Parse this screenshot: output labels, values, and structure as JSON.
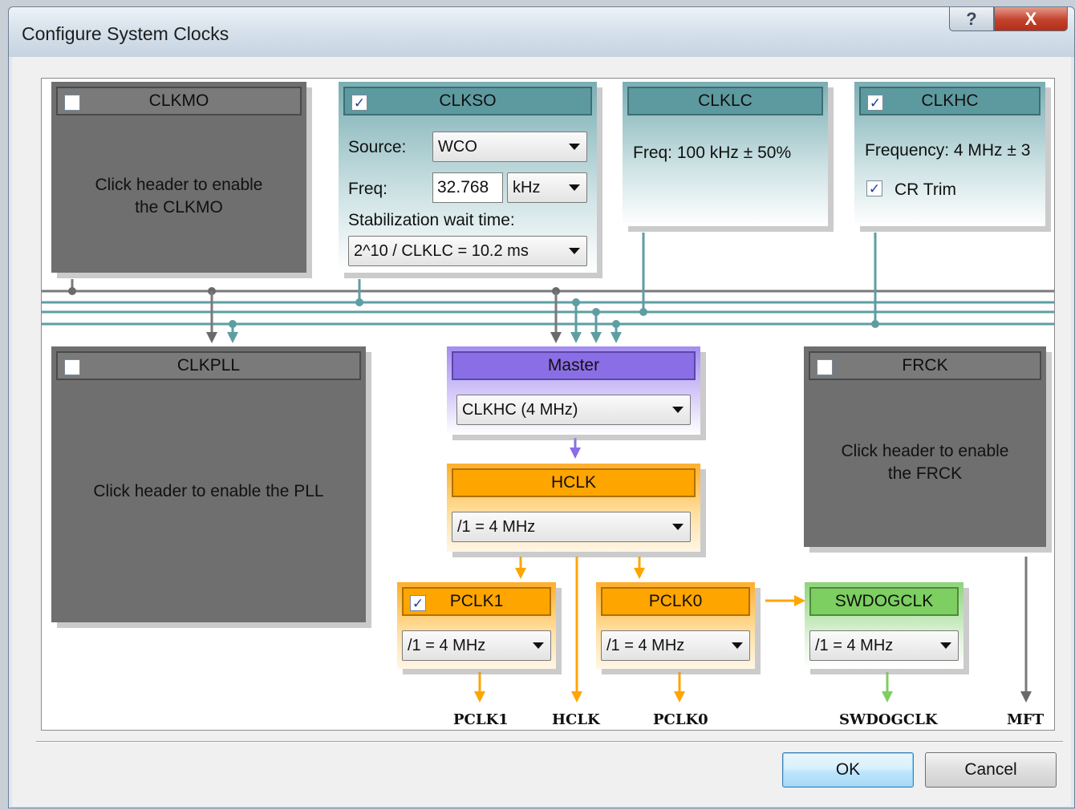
{
  "window": {
    "title": "Configure System Clocks",
    "help_glyph": "?",
    "close_glyph": "X"
  },
  "clkmo": {
    "title": "CLKMO",
    "enabled": false,
    "message": "Click header to enable the CLKMO"
  },
  "clkso": {
    "title": "CLKSO",
    "enabled": true,
    "source_label": "Source:",
    "source_value": "WCO",
    "freq_label": "Freq:",
    "freq_value": "32.768",
    "freq_unit": "kHz",
    "stab_label": "Stabilization wait time:",
    "stab_value": "2^10 / CLKLC = 10.2 ms"
  },
  "clklc": {
    "title": "CLKLC",
    "freq_text": "Freq: 100 kHz ± 50%"
  },
  "clkhc": {
    "title": "CLKHC",
    "enabled": true,
    "freq_text": "Frequency: 4 MHz ± 3",
    "cr_trim_label": "CR Trim",
    "cr_trim_checked": true
  },
  "clkpll": {
    "title": "CLKPLL",
    "enabled": false,
    "message": "Click header to enable the PLL"
  },
  "master": {
    "title": "Master",
    "value": "CLKHC (4 MHz)"
  },
  "frck": {
    "title": "FRCK",
    "enabled": false,
    "message": "Click header to enable the FRCK"
  },
  "hclk": {
    "title": "HCLK",
    "value": "/1 = 4 MHz"
  },
  "pclk1": {
    "title": "PCLK1",
    "enabled": true,
    "value": "/1 = 4 MHz"
  },
  "pclk0": {
    "title": "PCLK0",
    "value": "/1 = 4 MHz"
  },
  "swdogclk": {
    "title": "SWDOGCLK",
    "value": "/1 = 4 MHz"
  },
  "outputs": {
    "pclk1": "PCLK1",
    "hclk": "HCLK",
    "pclk0": "PCLK0",
    "swdogclk": "SWDOGCLK",
    "mft": "MFT"
  },
  "buttons": {
    "ok": "OK",
    "cancel": "Cancel"
  },
  "colors": {
    "gray_wire": "#7a7a7a",
    "teal_wire": "#5e9ea3",
    "purple_wire": "#8a6ee6",
    "orange_wire": "#ffa500",
    "green_wire": "#7ccf60"
  },
  "checkmark": "✓"
}
